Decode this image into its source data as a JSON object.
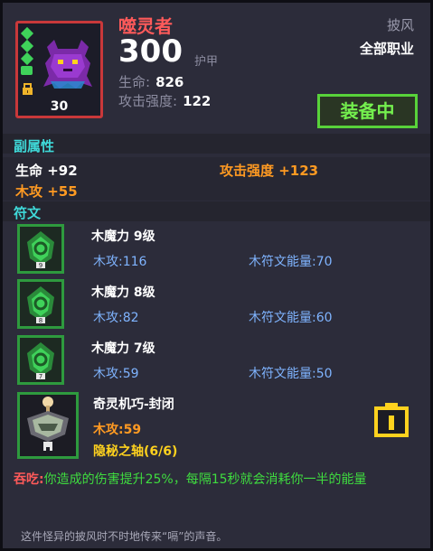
{
  "item": {
    "name": "噬灵者",
    "armor_value": "300",
    "armor_label": "护甲",
    "level": "30",
    "slot": "披风",
    "job": "全部职业",
    "stats": [
      {
        "label": "生命:",
        "value": "826"
      },
      {
        "label": "攻击强度:",
        "value": "122"
      }
    ],
    "equip_button": "装备中",
    "colors": {
      "name": "#ff5a5a",
      "frame": "#c9383a",
      "equip": "#58d23a"
    }
  },
  "sub_attributes": {
    "title": "副属性",
    "entries": [
      {
        "text": "生命 +92",
        "color": "#ffffff"
      },
      {
        "text": "攻击强度 +123",
        "color": "#ff9a22"
      },
      {
        "text": "木攻 +55",
        "color": "#ff9a22"
      }
    ]
  },
  "runes": {
    "title": "符文",
    "items": [
      {
        "name": "木魔力 9级",
        "attack": "木攻:116",
        "energy": "木符文能量:70",
        "icon": "wood-rune-icon",
        "numeral": "9"
      },
      {
        "name": "木魔力 8级",
        "attack": "木攻:82",
        "energy": "木符文能量:60",
        "icon": "wood-rune-icon",
        "numeral": "8"
      },
      {
        "name": "木魔力 7级",
        "attack": "木攻:59",
        "energy": "木符文能量:50",
        "icon": "wood-rune-icon",
        "numeral": "7"
      }
    ]
  },
  "set_piece": {
    "name": "奇灵机巧-封闭",
    "attack": "木攻:59",
    "bonus": "隐秘之轴(6/6)",
    "icon": "mechanism-icon",
    "button_icon": "socket-icon"
  },
  "effect": {
    "keyword": "吞吃:",
    "text": "你造成的伤害提升25%，每隔15秒就会消耗你一半的能量"
  },
  "flavor_text": "这件怪异的披风时不时地传来“嗝”的声音。"
}
